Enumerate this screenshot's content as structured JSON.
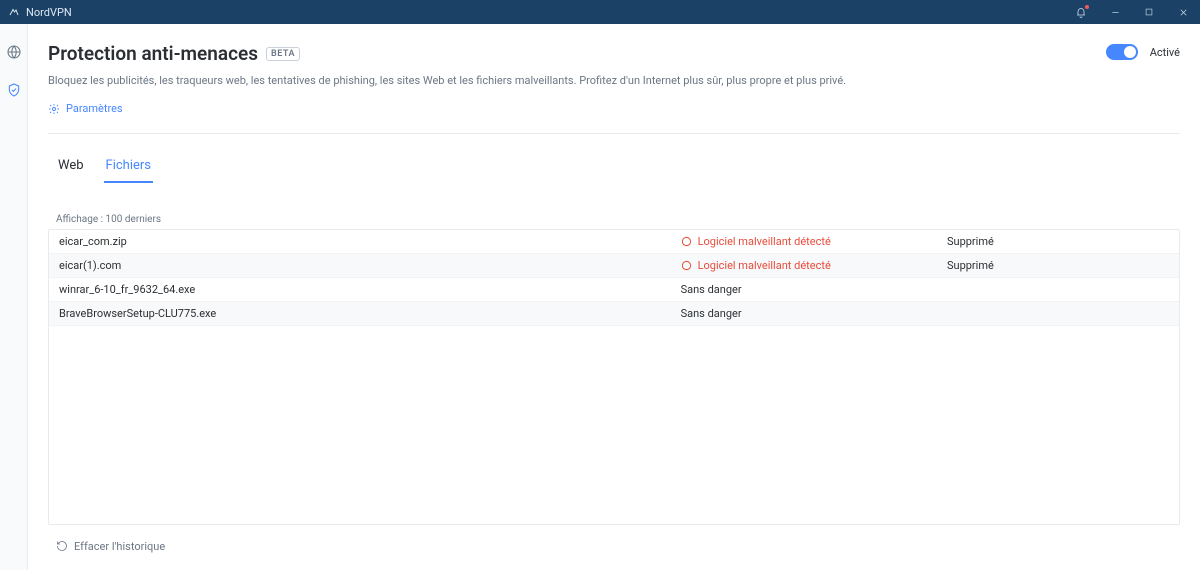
{
  "window": {
    "title": "NordVPN"
  },
  "header": {
    "title": "Protection anti-menaces",
    "badge": "BETA",
    "description": "Bloquez les publicités, les traqueurs web, les tentatives de phishing, les sites Web et les fichiers malveillants. Profitez d'un Internet plus sûr, plus propre et plus privé.",
    "settings_label": "Paramètres",
    "toggle_label": "Activé"
  },
  "tabs": {
    "web": "Web",
    "files": "Fichiers"
  },
  "list": {
    "info": "Affichage : 100 derniers",
    "rows": [
      {
        "name": "eicar_com.zip",
        "status": "Logiciel malveillant détecté",
        "status_type": "bad",
        "action": "Supprimé"
      },
      {
        "name": "eicar(1).com",
        "status": "Logiciel malveillant détecté",
        "status_type": "bad",
        "action": "Supprimé"
      },
      {
        "name": "winrar_6-10_fr_9632_64.exe",
        "status": "Sans danger",
        "status_type": "ok",
        "action": ""
      },
      {
        "name": "BraveBrowserSetup-CLU775.exe",
        "status": "Sans danger",
        "status_type": "ok",
        "action": ""
      }
    ]
  },
  "footer": {
    "clear_label": "Effacer l'historique"
  }
}
